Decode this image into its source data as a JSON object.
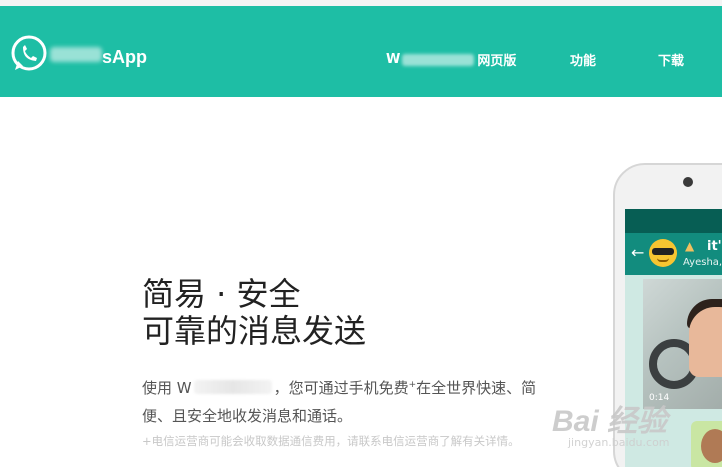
{
  "header": {
    "brand": "sApp",
    "nav": {
      "web_prefix": "W",
      "web_suffix": "网页版",
      "features": "功能",
      "download": "下载"
    }
  },
  "hero": {
    "title_line1": "简易 · 安全",
    "title_line2": "可靠的消息发送",
    "desc_prefix": "使用 W",
    "desc_rest": "，您可通过手机免费",
    "desc_sup": "+",
    "desc_tail": "在全世界快速、简便、且安全地收发消息和通话。",
    "note": "+电信运营商可能会收取数据通信费用，请联系电信运营商了解有关详情。"
  },
  "phone": {
    "chat_title": "it's",
    "chat_subtitle": "Ayesha,",
    "video_duration": "0:14"
  },
  "watermark": {
    "main": "Bai 经验",
    "sub": "jingyan.baidu.com"
  },
  "colors": {
    "brand_green": "#1ebea5",
    "dark_teal": "#075e54",
    "chat_header": "#128c7e"
  },
  "icons": {
    "logo": "whatsapp-logo-icon",
    "back": "back-arrow-icon"
  }
}
